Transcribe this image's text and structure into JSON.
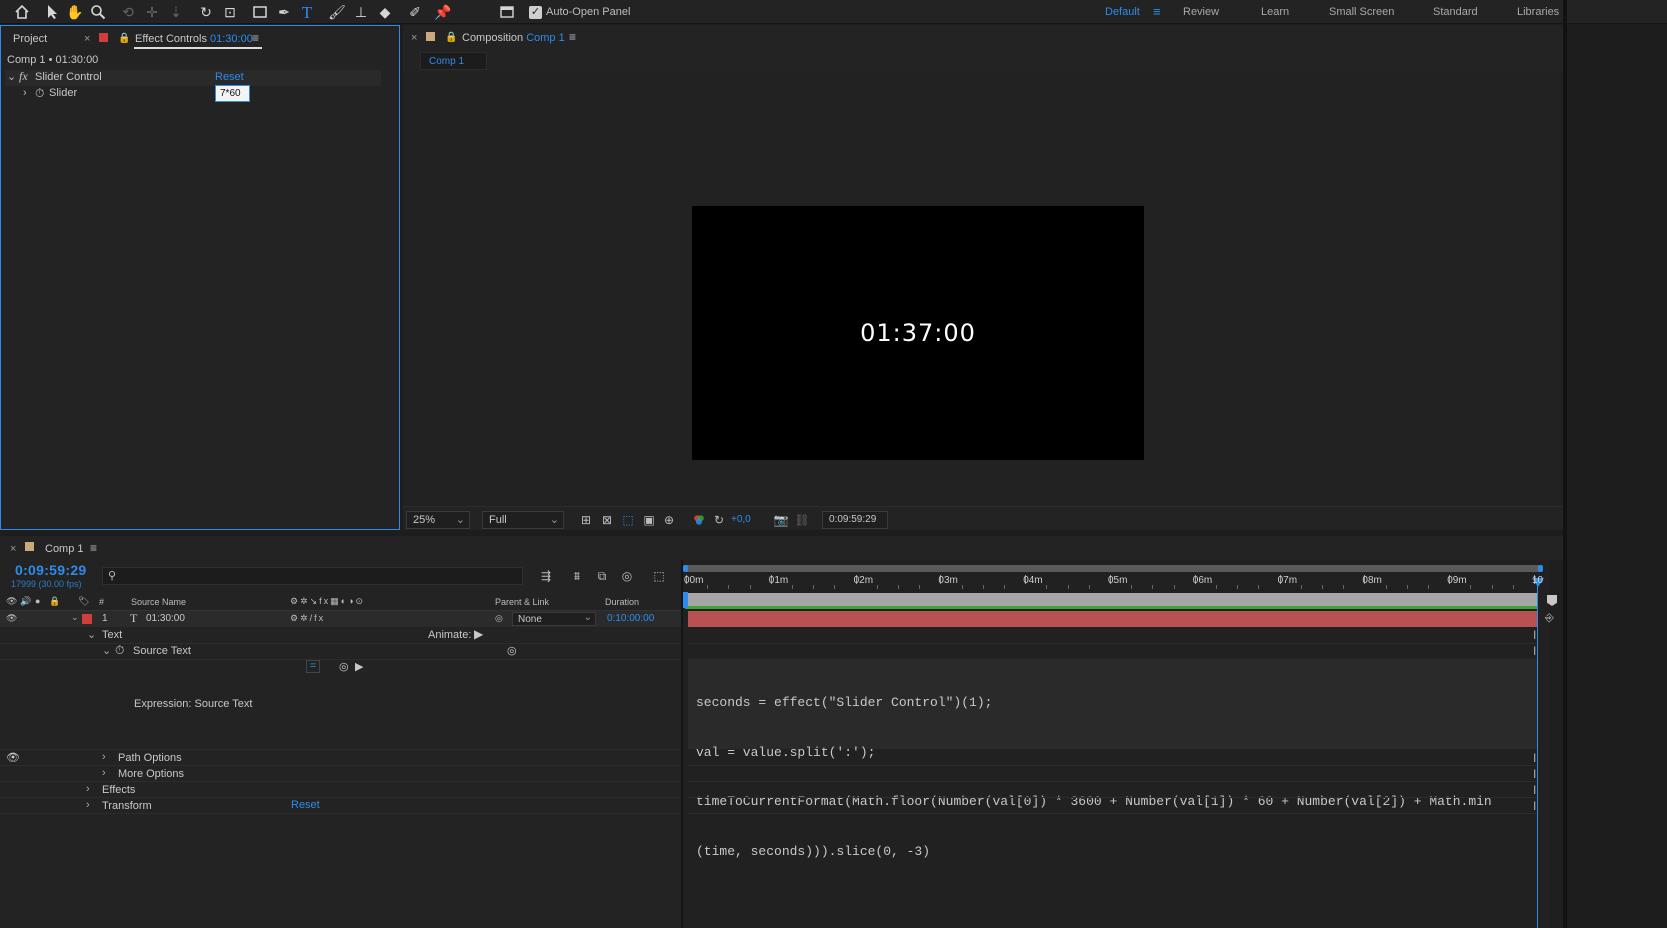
{
  "toolbar": {
    "auto_open_label": "Auto-Open Panel",
    "auto_open_checked": true,
    "workspaces": [
      "Default",
      "Review",
      "Learn",
      "Small Screen",
      "Standard",
      "Libraries"
    ],
    "active_workspace": "Default"
  },
  "effect_panel": {
    "project_tab": "Project",
    "tab_prefix": "Effect Controls",
    "tab_layer": "01:30:00",
    "breadcrumb": "Comp 1 • 01:30:00",
    "effect_name": "Slider Control",
    "reset_label": "Reset",
    "param_name": "Slider",
    "param_value": "7*60"
  },
  "comp_panel": {
    "tab_prefix": "Composition",
    "tab_name": "Comp 1",
    "subtab": "Comp 1",
    "canvas_text": "01:37:00",
    "zoom": "25%",
    "resolution": "Full",
    "exposure": "+0,0",
    "timecode": "0:09:59:29"
  },
  "timeline": {
    "tab": "Comp 1",
    "timecode": "0:09:59:29",
    "frames": "17999 (30.00 fps)",
    "search_placeholder": "",
    "headers": {
      "num": "#",
      "source_name": "Source Name",
      "parent": "Parent & Link",
      "duration": "Duration"
    },
    "layer": {
      "index": "1",
      "name": "01:30:00",
      "parent": "None",
      "duration": "0:10:00:00"
    },
    "props": {
      "text": "Text",
      "animate": "Animate:",
      "source_text": "Source Text",
      "expression_label": "Expression: Source Text",
      "path_options": "Path Options",
      "more_options": "More Options",
      "effects": "Effects",
      "transform": "Transform",
      "reset": "Reset"
    },
    "ruler": [
      "00m",
      "01m",
      "02m",
      "03m",
      "04m",
      "05m",
      "06m",
      "07m",
      "08m",
      "09m",
      "10"
    ],
    "expression_lines": [
      "seconds = effect(\"Slider Control\")(1);",
      "val = value.split(':');",
      "timeToCurrentFormat(Math.floor(Number(val[0]) * 3600 + Number(val[1]) * 60 + Number(val[2]) + Math.min",
      "(time, seconds))).slice(0, -3)"
    ]
  },
  "colors": {
    "accent": "#2d8ceb",
    "layer_bar": "#b85252",
    "label_red": "#d03d3d",
    "comp_swatch": "#c8a97a",
    "work_area_green": "#35a835"
  }
}
